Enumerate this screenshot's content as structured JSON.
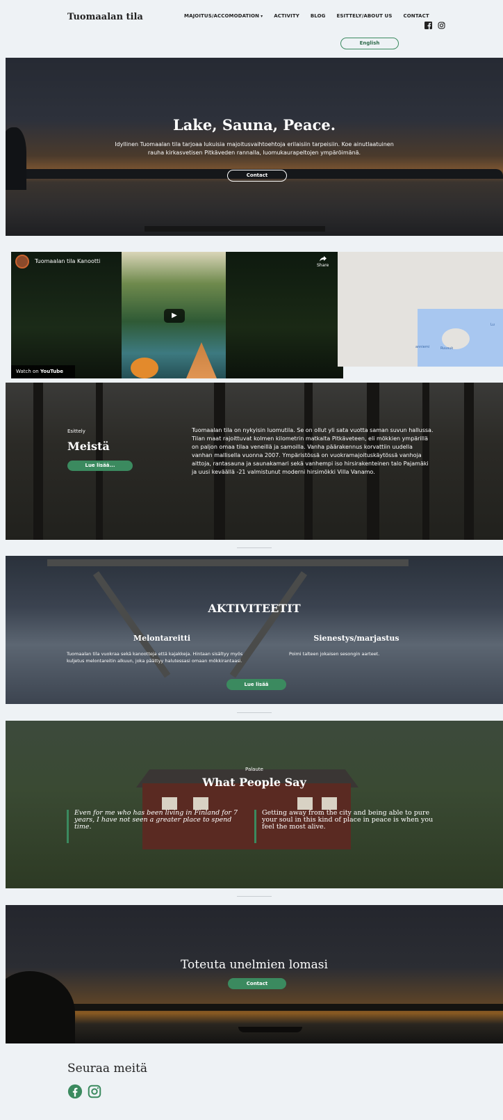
{
  "header": {
    "brand": "Tuomaalan tila",
    "nav": [
      {
        "label": "MAJOITUS/ACCOMODATION"
      },
      {
        "label": "ACTIVITY"
      },
      {
        "label": "BLOG"
      },
      {
        "label": "ESITTELY/ABOUT US"
      },
      {
        "label": "CONTACT"
      }
    ],
    "nav_caret": "▾",
    "language_button": "English",
    "social_icons": [
      "facebook-icon",
      "instagram-icon"
    ]
  },
  "hero": {
    "title": "Lake, Sauna, Peace.",
    "text": "Idyllinen Tuomaalan tila tarjoaa lukuisia majoitusvaihtoehtoja erilaisiin tarpeisiin. Koe ainutlaatuinen rauha kirkasvetisen Pitkäveden rannalla, luomukaurapeltojen ympäröimänä.",
    "button": "Contact"
  },
  "video": {
    "channel_title": "Tuomaalan tila Kanootti",
    "share_label": "Share",
    "watch_on": "Watch on",
    "youtube_label": "YouTube",
    "play_icon": "play-icon"
  },
  "map": {
    "labels": [
      "Lu",
      "anniemi",
      "Ruusuk"
    ]
  },
  "about": {
    "eyebrow": "Esittely",
    "title": "Meistä",
    "button": "Lue lisää...",
    "text": "Tuomaalan tila on nykyisin luomutila. Se on ollut yli sata vuotta saman suvun hallussa. Tilan maat rajoittuvat kolmen kilometrin matkalta Pitkäveteen, eli mökkien ympärillä on paljon omaa tilaa veneillä ja samoilla. Vanha päärakennus korvattiin uudella vanhan mallisella vuonna 2007. Ympäristössä on vuokramajoituskäytössä vanhoja aittoja, rantasauna ja saunakamari sekä vanhempi iso hirsirakenteinen talo Pajamäki ja uusi keväällä -21 valmistunut moderni hirsimökki Villa Vanamo."
  },
  "activities": {
    "title": "AKTIVITEETIT",
    "items": [
      {
        "heading": "Melontareitti",
        "text": "Tuomaalan tila vuokraa sekä kanootteja että kajakkeja. Hintaan sisältyy myös kuljetus melontareitin alkuun, joka päättyy halutessasi omaan mökkirantaasi."
      },
      {
        "heading": "Sienestys/marjastus",
        "text": "Poimi talteen jokaisen sesongin aarteet."
      }
    ],
    "button": "Lue lisää"
  },
  "testimonials": {
    "eyebrow": "Palaute",
    "title": "What People Say",
    "quotes": [
      {
        "text": "Even for me who has been living in Finland for 7 years, I have not seen a greater place to spend time."
      },
      {
        "text": "Getting away from the city and being able to pure your soul in this kind of place in peace is when you feel the most alive."
      }
    ]
  },
  "cta": {
    "title": "Toteuta unelmien lomasi",
    "button": "Contact"
  },
  "footer": {
    "follow_title": "Seuraa meitä",
    "social_icons": [
      "facebook-icon",
      "instagram-icon"
    ]
  },
  "colors": {
    "accent": "#3b8a5f",
    "background": "#eef2f5",
    "text": "#222222"
  }
}
